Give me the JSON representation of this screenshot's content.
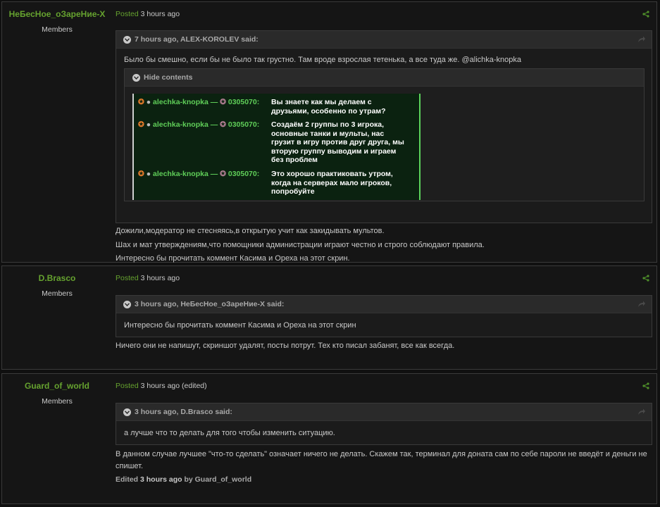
{
  "posts": [
    {
      "author": "НеБесНое_оЗареНие-X",
      "group": "Members",
      "posted_label": "Posted",
      "time": "3 hours ago",
      "quote": {
        "citation": "7 hours ago, ALEX-KOROLEV said:",
        "text": "Было бы смешно, если бы не было так грустно. Там вроде взрослая тетенька, а все туда же. @alichka-knopka",
        "spoiler_label": "Hide contents",
        "chat": [
          {
            "user": "alechka-knopka —",
            "id": "0305070:",
            "msg": "Вы знаете как мы делаем с друзьями, особенно по утрам?"
          },
          {
            "user": "alechka-knopka —",
            "id": "0305070:",
            "msg": "Создаём 2 группы по 3 игрока, основные танки и мульты, нас грузит в игру против друг друга, мы вторую группу выводим и играем без проблем"
          },
          {
            "user": "alechka-knopka —",
            "id": "0305070:",
            "msg": "Это хорошо практиковать утром, когда на серверах мало игроков, попробуйте"
          }
        ]
      },
      "paragraphs": [
        "Дожили,модератор не стесняясь,в открытую учит как закидывать мультов.",
        "Шах и мат утверждениям,что помощники администрации играют честно и строго соблюдают правила.",
        "Интересно бы  прочитать коммент   Касима и Ореха на этот скрин."
      ]
    },
    {
      "author": "D.Brasco",
      "group": "Members",
      "posted_label": "Posted",
      "time": "3 hours ago",
      "quote": {
        "citation": "3 hours ago, НеБесНое_оЗареНие-X said:",
        "text": "Интересно бы  прочитать коммент   Касима и Ореха на этот скрин"
      },
      "paragraphs": [
        "Ничего они не напишут, скриншот удалят, посты потрут. Тех кто писал забанят, все как всегда."
      ]
    },
    {
      "author": "Guard_of_world",
      "group": "Members",
      "posted_label": "Posted",
      "time": "3 hours ago",
      "edited_flag": "(edited)",
      "quote": {
        "citation": "3 hours ago, D.Brasco said:",
        "text": "а лучше что то делать для того чтобы изменить ситуацию."
      },
      "paragraphs": [
        "В данном случае лучшее \"что-то сделать\" означает ничего не делать. Скажем так, терминал для доната сам по себе пароли не введёт и деньги не спишет."
      ],
      "edited_note": {
        "prefix": "Edited",
        "time": "3 hours ago",
        "by": "by Guard_of_world"
      }
    }
  ],
  "colors": {
    "accent": "#66a32f",
    "background": "#101010",
    "panel": "#151515",
    "quote_head": "#2a2a2a"
  }
}
